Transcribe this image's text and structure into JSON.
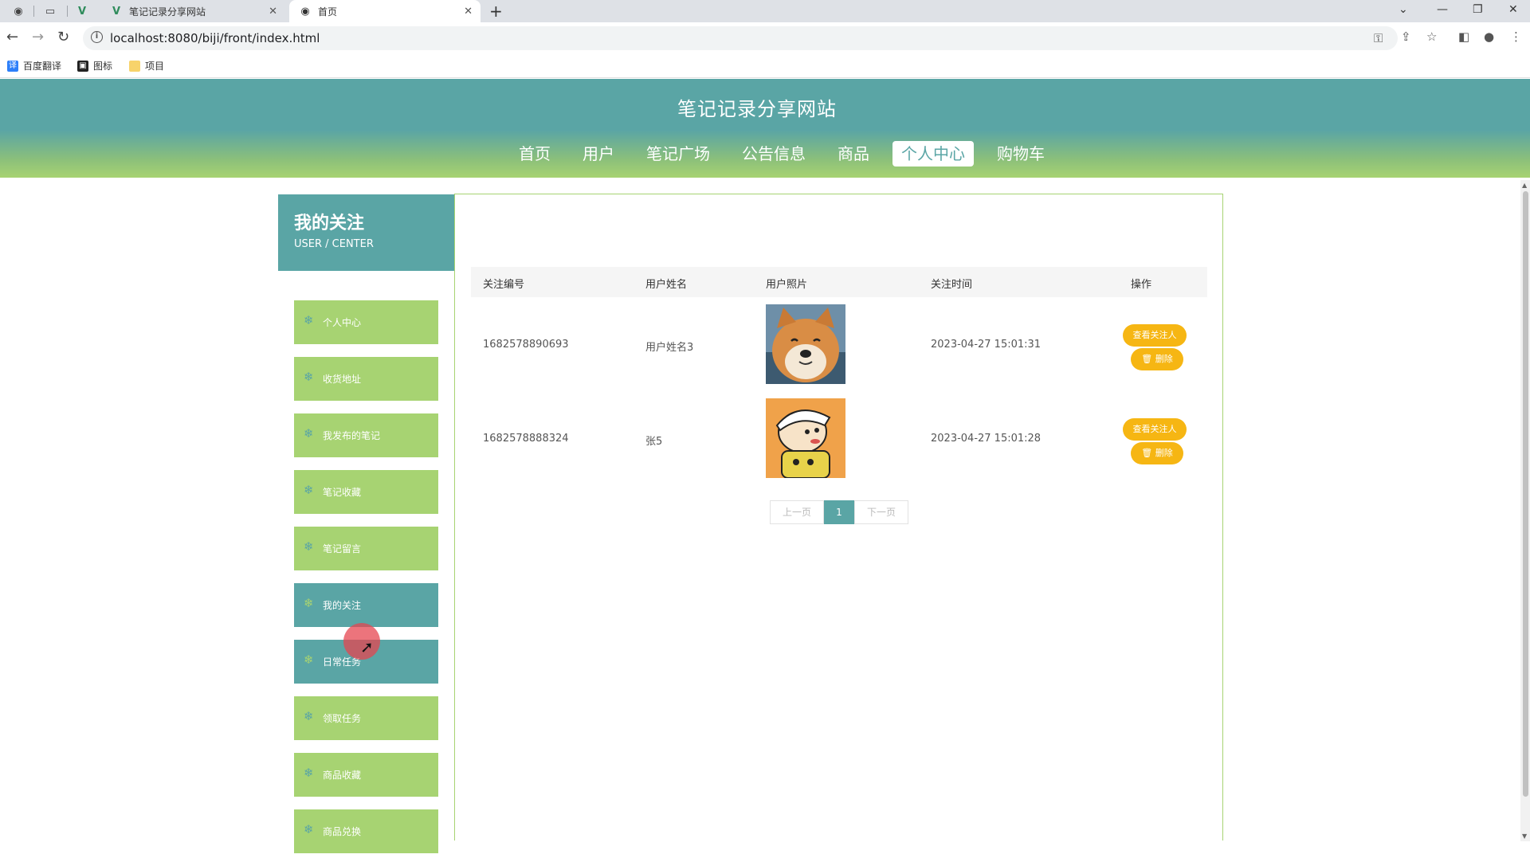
{
  "browser": {
    "tabs": [
      {
        "title": "笔记记录分享网站",
        "active": false
      },
      {
        "title": "首页",
        "active": true
      }
    ],
    "url": "localhost:8080/biji/front/index.html",
    "bookmarks": [
      {
        "label": "百度翻译",
        "icon": "translate-icon"
      },
      {
        "label": "图标",
        "icon": "image-icon"
      },
      {
        "label": "项目",
        "icon": "folder-icon"
      }
    ],
    "tab_close": "✕",
    "new_tab": "+"
  },
  "header": {
    "site_title": "笔记记录分享网站",
    "nav": [
      "首页",
      "用户",
      "笔记广场",
      "公告信息",
      "商品",
      "个人中心",
      "购物车"
    ],
    "active_nav": "个人中心"
  },
  "sidebar": {
    "title": "我的关注",
    "subtitle": "USER / CENTER",
    "items": [
      "个人中心",
      "收货地址",
      "我发布的笔记",
      "笔记收藏",
      "笔记留言",
      "我的关注",
      "日常任务",
      "领取任务",
      "商品收藏",
      "商品兑换"
    ],
    "active_items": [
      "我的关注",
      "日常任务"
    ],
    "item_icon": "snowflake-icon"
  },
  "table": {
    "columns": [
      "关注编号",
      "用户姓名",
      "用户照片",
      "关注时间",
      "操作"
    ],
    "rows": [
      {
        "id": "1682578890693",
        "name": "用户姓名3",
        "photo": "shiba-dog-photo",
        "time": "2023-04-27 15:01:31"
      },
      {
        "id": "1682578888324",
        "name": "张5",
        "photo": "cartoon-boy-photo",
        "time": "2023-04-27 15:01:28"
      }
    ],
    "view_label": "查看关注人",
    "delete_label": "删除"
  },
  "pagination": {
    "prev": "上一页",
    "current": "1",
    "next": "下一页"
  },
  "colors": {
    "primary_teal": "#5aa5a5",
    "accent_green": "#a7d372",
    "button_yellow": "#f6b613"
  }
}
